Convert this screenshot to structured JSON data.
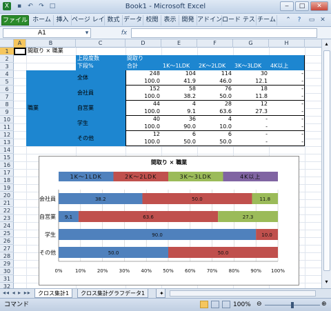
{
  "window": {
    "title": "Book1 - Microsoft Excel"
  },
  "ribbon": {
    "tabs": [
      "ファイル",
      "ホーム",
      "挿入",
      "ページ レイ",
      "数式",
      "データ",
      "校閲",
      "表示",
      "開発",
      "アドイン",
      "ロード テスト",
      "チーム"
    ]
  },
  "formula_bar": {
    "cell_ref": "A1",
    "fx": "fx",
    "formula": ""
  },
  "columns": [
    "A",
    "B",
    "C",
    "D",
    "E",
    "F",
    "G",
    "H"
  ],
  "rows": [
    "1",
    "2",
    "3",
    "4",
    "5",
    "6",
    "7",
    "8",
    "9",
    "10",
    "11",
    "12",
    "13",
    "14",
    "15",
    "16",
    "17",
    "18",
    "19",
    "20",
    "21",
    "22",
    "23",
    "24",
    "25",
    "26",
    "27",
    "28",
    "29",
    "30",
    "31",
    "32"
  ],
  "table": {
    "title": "間取り × 職業",
    "header_top_left": "上段度数",
    "header_bottom_left": "下段%",
    "header_group": "間取り",
    "col_headers": [
      "合計",
      "1K～1LDK",
      "2K～2LDK",
      "3K～3LDK",
      "4K以上"
    ],
    "row_group": "職業",
    "rows": [
      {
        "label": "全体",
        "counts": [
          "248",
          "104",
          "114",
          "30",
          "-"
        ],
        "pcts": [
          "100.0",
          "41.9",
          "46.0",
          "12.1",
          "-"
        ]
      },
      {
        "label": "会社員",
        "counts": [
          "152",
          "58",
          "76",
          "18",
          "-"
        ],
        "pcts": [
          "100.0",
          "38.2",
          "50.0",
          "11.8",
          "-"
        ]
      },
      {
        "label": "自営業",
        "counts": [
          "44",
          "4",
          "28",
          "12",
          "-"
        ],
        "pcts": [
          "100.0",
          "9.1",
          "63.6",
          "27.3",
          "-"
        ]
      },
      {
        "label": "学生",
        "counts": [
          "40",
          "36",
          "4",
          "-",
          "-"
        ],
        "pcts": [
          "100.0",
          "90.0",
          "10.0",
          "-",
          "-"
        ]
      },
      {
        "label": "その他",
        "counts": [
          "12",
          "6",
          "6",
          "-",
          "-"
        ],
        "pcts": [
          "100.0",
          "50.0",
          "50.0",
          "-",
          "-"
        ]
      }
    ]
  },
  "chart_data": {
    "type": "bar",
    "orientation": "horizontal",
    "stacked": "percent",
    "title": "間取り × 職業",
    "categories": [
      "会社員",
      "自営業",
      "学生",
      "その他"
    ],
    "series": [
      {
        "name": "1K～1LDK",
        "color": "#4f81bd",
        "values": [
          38.2,
          9.1,
          90.0,
          50.0
        ]
      },
      {
        "name": "2K～2LDK",
        "color": "#c0504d",
        "values": [
          50.0,
          63.6,
          10.0,
          50.0
        ]
      },
      {
        "name": "3K～3LDK",
        "color": "#9bbb59",
        "values": [
          11.8,
          27.3,
          0,
          0
        ]
      },
      {
        "name": "4K以上",
        "color": "#8064a2",
        "values": [
          0,
          0,
          0,
          0
        ]
      }
    ],
    "x_ticks": [
      "0%",
      "10%",
      "20%",
      "30%",
      "40%",
      "50%",
      "60%",
      "70%",
      "80%",
      "90%",
      "100%"
    ],
    "xlim": [
      0,
      100
    ],
    "legend": "top",
    "grid": true
  },
  "sheet_tabs": [
    "クロス集計1",
    "クロス集計グラフデータ1"
  ],
  "status": {
    "mode": "コマンド",
    "zoom": "100%"
  }
}
